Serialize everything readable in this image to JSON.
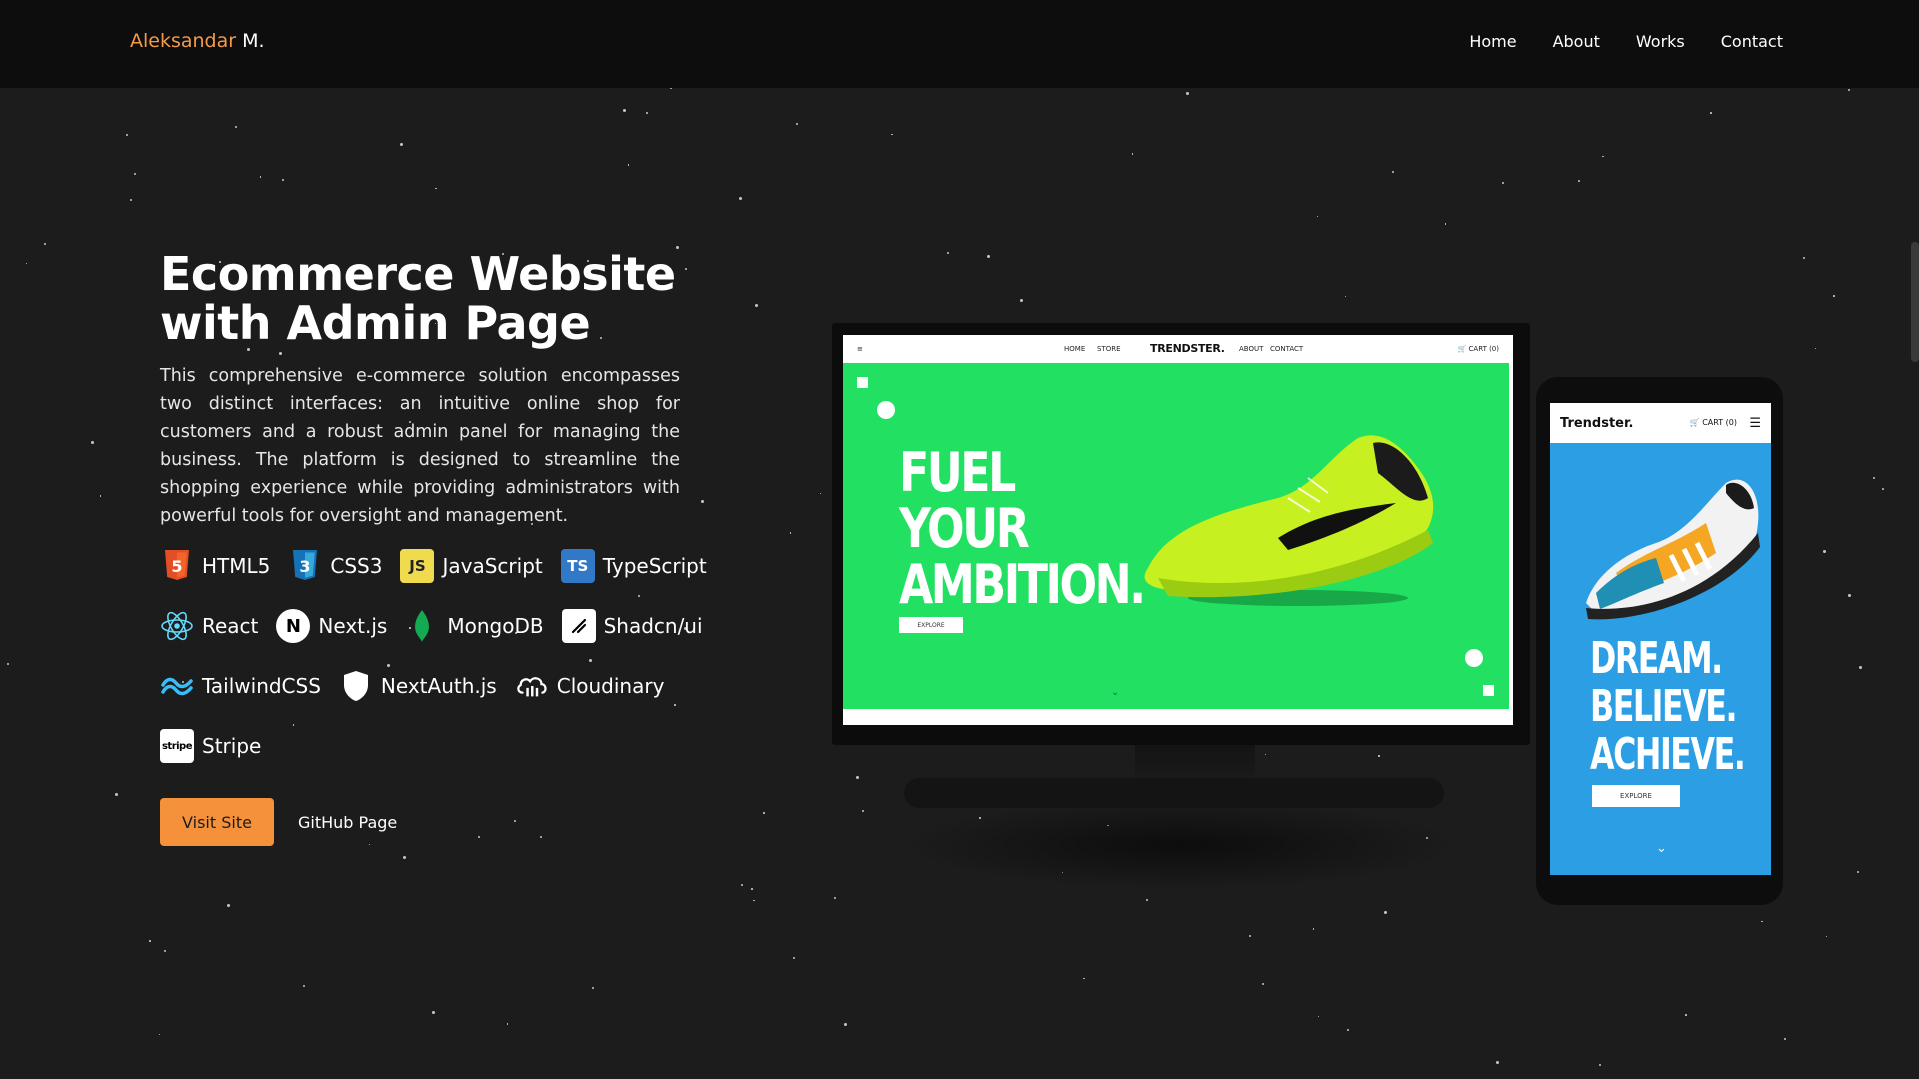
{
  "header": {
    "brand_first": "Aleksandar",
    "brand_last": "M.",
    "nav": [
      "Home",
      "About",
      "Works",
      "Contact"
    ]
  },
  "project": {
    "title_line1": "Ecommerce Website",
    "title_line2": "with Admin Page",
    "description": "This comprehensive e-commerce solution encompasses two distinct interfaces: an intuitive online shop for customers and a robust admin panel for managing the business. The platform is designed to streamline the shopping experience while providing administrators with powerful tools for oversight and management.",
    "tech": [
      {
        "label": "HTML5",
        "icon": "html5-icon"
      },
      {
        "label": "CSS3",
        "icon": "css3-icon"
      },
      {
        "label": "JavaScript",
        "icon": "javascript-icon"
      },
      {
        "label": "TypeScript",
        "icon": "typescript-icon"
      },
      {
        "label": "React",
        "icon": "react-icon"
      },
      {
        "label": "Next.js",
        "icon": "nextjs-icon"
      },
      {
        "label": "MongoDB",
        "icon": "mongodb-icon"
      },
      {
        "label": "Shadcn/ui",
        "icon": "shadcn-icon"
      },
      {
        "label": "TailwindCSS",
        "icon": "tailwind-icon"
      },
      {
        "label": "NextAuth.js",
        "icon": "nextauth-icon"
      },
      {
        "label": "Cloudinary",
        "icon": "cloudinary-icon"
      },
      {
        "label": "Stripe",
        "icon": "stripe-icon"
      }
    ],
    "visit_label": "Visit Site",
    "github_label": "GitHub Page"
  },
  "desktop_preview": {
    "nav_home": "HOME",
    "nav_store": "STORE",
    "logo": "TRENDSTER.",
    "nav_about": "ABOUT",
    "nav_contact": "CONTACT",
    "cart": "CART (0)",
    "hero_line1": "FUEL",
    "hero_line2": "YOUR",
    "hero_line3": "AMBITION.",
    "explore": "EXPLORE"
  },
  "mobile_preview": {
    "logo": "Trendster.",
    "cart": "CART (0)",
    "hero_line1": "DREAM.",
    "hero_line2": "BELIEVE.",
    "hero_line3": "ACHIEVE.",
    "explore": "EXPLORE"
  },
  "colors": {
    "accent": "#f5913a",
    "background": "#1c1c1c",
    "header_bg": "#0d0d0d",
    "desktop_hero": "#22e061",
    "mobile_hero": "#2c9ee4"
  }
}
